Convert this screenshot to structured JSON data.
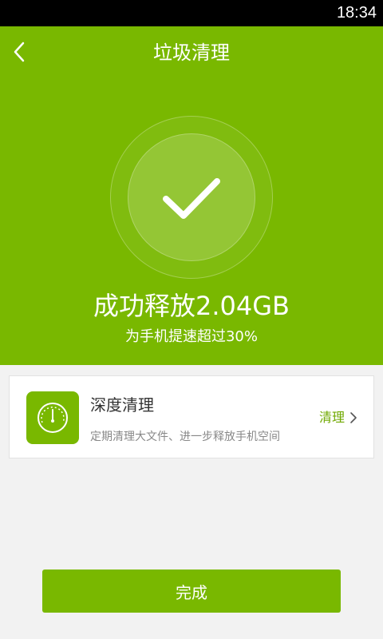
{
  "status_bar": {
    "time": "18:34"
  },
  "header": {
    "title": "垃圾清理",
    "back_icon": "chevron-left-icon"
  },
  "result": {
    "headline": "成功释放2.04GB",
    "subline": "为手机提速超过30%",
    "icon": "checkmark-icon"
  },
  "deep_clean_card": {
    "icon": "speedometer-icon",
    "title": "深度清理",
    "description": "定期清理大文件、进一步释放手机空间",
    "action_label": "清理",
    "action_icon": "chevron-right-icon"
  },
  "footer": {
    "done_label": "完成"
  },
  "colors": {
    "accent": "#79b800",
    "background": "#f2f2f2",
    "action_text": "#6fa800"
  }
}
